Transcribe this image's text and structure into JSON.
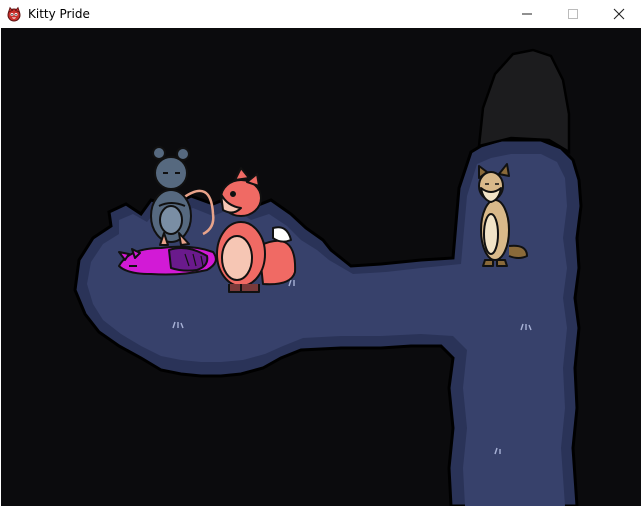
{
  "window": {
    "title": "Kitty Pride",
    "app_icon": "cat-face-icon",
    "controls": [
      "minimize-icon",
      "maximize-icon",
      "close-icon"
    ]
  },
  "scene": {
    "background_color": "#0b0b0d",
    "floor_color": "#37416b",
    "floor_edge_color": "#2a3358",
    "cave_opening_color": "#1c1c1e",
    "characters": [
      {
        "name": "gray-rat",
        "color": "#56697f"
      },
      {
        "name": "purple-cat-lying",
        "color": "#d21ad6"
      },
      {
        "name": "red-fox",
        "color": "#f06a64"
      },
      {
        "name": "tan-ferret",
        "color": "#d9b98a"
      }
    ]
  }
}
